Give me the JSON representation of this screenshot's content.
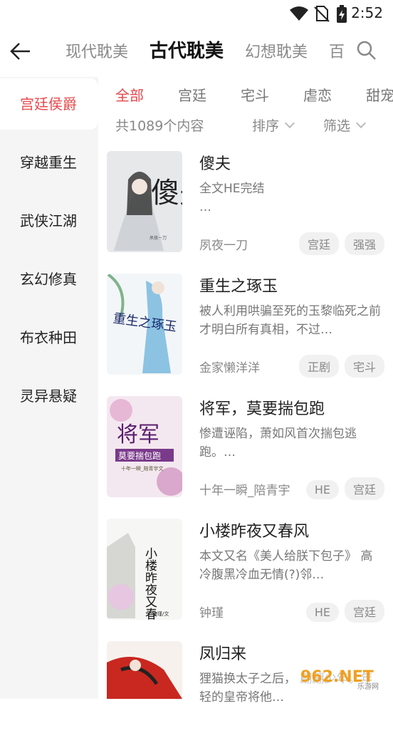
{
  "status_bar": {
    "time": "2:52"
  },
  "top_tabs": [
    "现代耽美",
    "古代耽美",
    "幻想耽美",
    "百"
  ],
  "active_top_tab": 1,
  "sidebar": {
    "items": [
      {
        "label": "宫廷侯爵"
      },
      {
        "label": "穿越重生"
      },
      {
        "label": "武侠江湖"
      },
      {
        "label": "玄幻修真"
      },
      {
        "label": "布衣种田"
      },
      {
        "label": "灵异悬疑"
      }
    ]
  },
  "sub_tabs": [
    "全部",
    "宫廷",
    "宅斗",
    "虐恋",
    "甜宠"
  ],
  "filter": {
    "count": "共1089个内容",
    "sort": "排序",
    "filter": "筛选"
  },
  "books": [
    {
      "title": "傻夫",
      "desc": "全文HE完结\n…",
      "author": "夙夜一刀",
      "tags": [
        "宫廷",
        "强强"
      ],
      "cover_text": "傻夫",
      "cover_sub": "夙夜一刀"
    },
    {
      "title": "重生之琢玉",
      "desc": "被人利用哄骗至死的玉黎临死之前才明白所有真相，不过…",
      "author": "金家懒洋洋",
      "tags": [
        "正剧",
        "宅斗"
      ],
      "cover_text": "重生之琢玉",
      "cover_sub": "金家懒洋洋"
    },
    {
      "title": "将军，莫要揣包跑",
      "desc": "惨遭诬陷，萧如风首次揣包逃跑。…",
      "author": "十年一瞬_陪青宇",
      "tags": [
        "HE",
        "宫廷"
      ],
      "cover_text": "将军",
      "cover_sub": "莫要揣包跑",
      "cover_sub2": "十年一瞬_陪青宇文"
    },
    {
      "title": "小楼昨夜又春风",
      "desc": "本文又名《美人给朕下包子》    高冷腹黑冷血无情(?)邻…",
      "author": "钟瑾",
      "tags": [
        "HE",
        "宫廷"
      ],
      "cover_text": "小楼昨夜又春风",
      "cover_sub": "钟瑾/文"
    },
    {
      "title": "凤归来",
      "desc": "狸猫换太子之后，  翩翩少年。年轻的皇帝将他…",
      "author": "",
      "tags": []
    }
  ],
  "watermark": {
    "text": "962.NET",
    "sub": "乐游网"
  }
}
